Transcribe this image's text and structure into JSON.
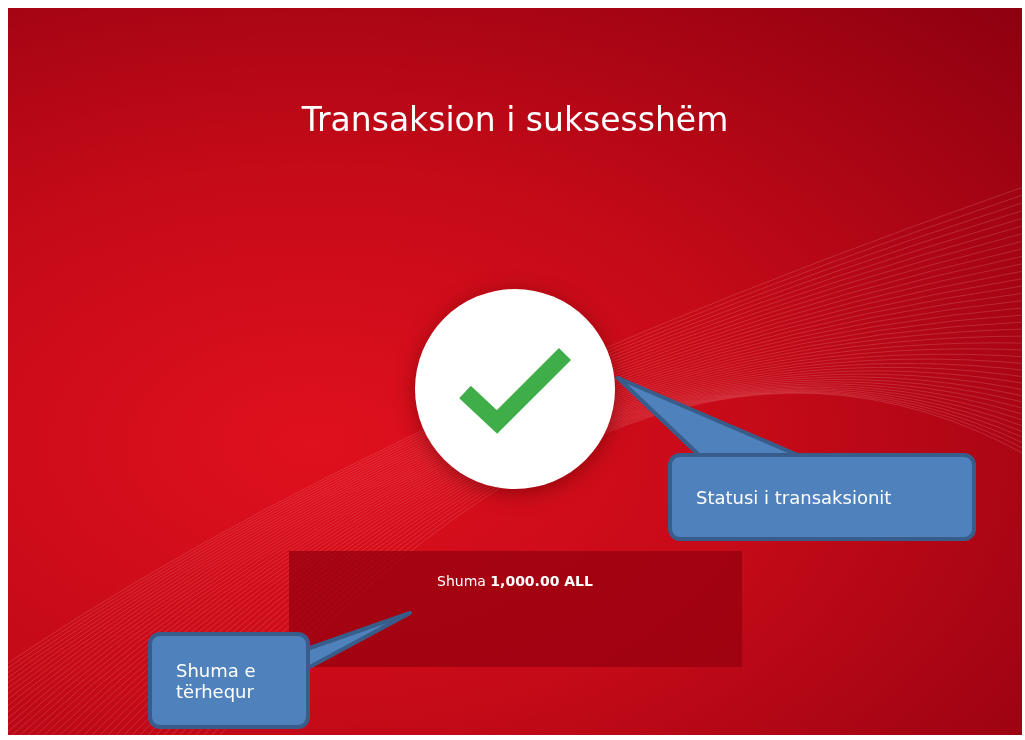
{
  "screen": {
    "title": "Transaksion i suksesshëm",
    "status": {
      "kind": "success"
    },
    "amount": "Shuma **1,000.00 ALL**"
  },
  "callouts": [
    {
      "text": "Statusi i transaksionit"
    },
    {
      "text": "Shuma e tërhequr"
    }
  ]
}
